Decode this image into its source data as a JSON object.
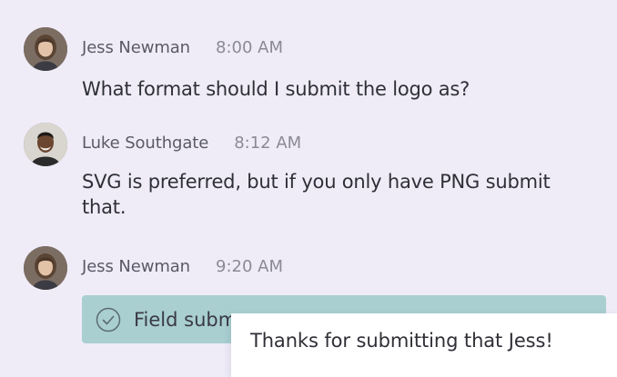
{
  "messages": [
    {
      "author": "Jess Newman",
      "time": "8:00 AM",
      "text": "What format should I submit the logo as?",
      "avatar_icon": "avatar-jess-newman"
    },
    {
      "author": "Luke Southgate",
      "time": "8:12 AM",
      "text": "SVG is preferred, but if you only have PNG submit that.",
      "avatar_icon": "avatar-luke-southgate"
    },
    {
      "author": "Jess Newman",
      "time": "9:20 AM",
      "avatar_icon": "avatar-jess-newman"
    }
  ],
  "attachment": {
    "label": "Field subm",
    "icon": "check-circle-icon",
    "color": "#a9cfd1"
  },
  "tooltip": {
    "text": "Thanks for submitting that Jess!"
  },
  "colors": {
    "background": "#efecf8",
    "text": "#2f2f37",
    "muted": "#8a8a95"
  }
}
